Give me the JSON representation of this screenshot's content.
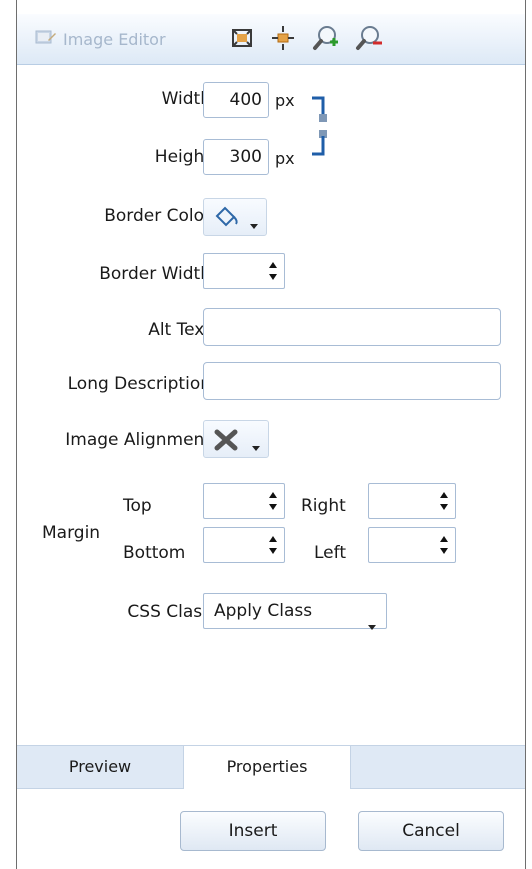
{
  "toolbar": {
    "title": "Image Editor",
    "icons": [
      "image-editor-icon",
      "fit-to-window-icon",
      "original-size-icon",
      "zoom-in-icon",
      "zoom-out-icon"
    ]
  },
  "form": {
    "width_label": "Width",
    "width_value": "400",
    "height_label": "Height",
    "height_value": "300",
    "unit": "px",
    "border_color_label": "Border Color",
    "border_width_label": "Border Width",
    "alt_text_label": "Alt Text",
    "long_description_label": "Long Description",
    "image_alignment_label": "Image Alignment",
    "margin_label": "Margin",
    "margin_top_label": "Top",
    "margin_right_label": "Right",
    "margin_bottom_label": "Bottom",
    "margin_left_label": "Left",
    "css_class_label": "CSS Class",
    "css_class_value": "Apply Class"
  },
  "tabs": [
    "Preview",
    "Properties"
  ],
  "active_tab": "Properties",
  "buttons": {
    "insert": "Insert",
    "cancel": "Cancel"
  },
  "colors": {
    "accent": "#1f5ea8",
    "toolbar_bg": "#dde9f6",
    "border": "#a8bcd5"
  }
}
